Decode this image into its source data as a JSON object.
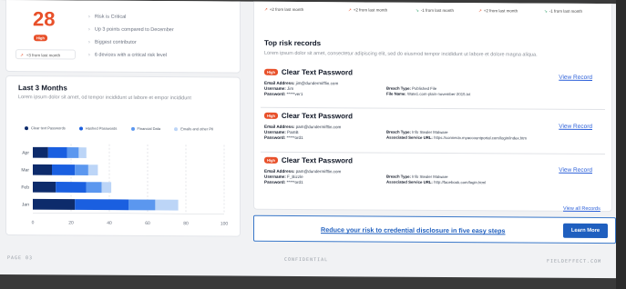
{
  "summary": {
    "risk_score": "28",
    "risk_level": "High",
    "trend_text": "+3 from last month",
    "bullets": [
      "Risk is Critical",
      "Up 3 points compared to December",
      "Biggest contributor",
      "6 devices with a critical risk level"
    ]
  },
  "last_3_months": {
    "title": "Last 3 Months",
    "subtitle": "Lorem ipsum dolor sit amet, od tempor incididunt ut labore et empor incididunt"
  },
  "top_trends": [
    {
      "text": "+2 from last month",
      "direction": "up"
    },
    {
      "text": "+2 from last month",
      "direction": "up"
    },
    {
      "text": "-1 from last month",
      "direction": "down"
    },
    {
      "text": "+2 from last month",
      "direction": "up"
    },
    {
      "text": "-1 from last month",
      "direction": "down"
    }
  ],
  "colors": {
    "accent": "#e8502a",
    "link": "#2b5fd9",
    "cta": "#1f5fbf",
    "series": [
      "#0d2b6b",
      "#1a5fe0",
      "#5b97ef",
      "#bcd5f7"
    ]
  },
  "chart_data": {
    "type": "bar",
    "orientation": "horizontal",
    "stacked": true,
    "categories": [
      "Apr",
      "Mar",
      "Feb",
      "Jan"
    ],
    "series": [
      {
        "name": "Clear text Passwords",
        "values": [
          8,
          10,
          12,
          22
        ]
      },
      {
        "name": "Hashed Passwords",
        "values": [
          10,
          12,
          16,
          28
        ]
      },
      {
        "name": "Financial Data",
        "values": [
          6,
          7,
          8,
          14
        ]
      },
      {
        "name": "Emails and other PII",
        "values": [
          4,
          5,
          5,
          12
        ]
      }
    ],
    "xlim": [
      0,
      100
    ],
    "xticks": [
      "0",
      "20",
      "40",
      "60",
      "80",
      "100"
    ],
    "legend": "top",
    "grid": true
  },
  "records_section": {
    "title": "Top risk records",
    "subtitle": "Lorem ipsum dolor sit amet, consectetur adipiscing elit, sed do eiusmod tempor incididunt ut labore et dolore magna aliqua.",
    "view_label": "View Record",
    "view_all": "View all Records"
  },
  "records": [
    {
      "badge": "High",
      "title": "Clear Text Password",
      "left": [
        {
          "label": "Email Address:",
          "value": "jim@dundermifflin.com"
        },
        {
          "label": "Username:",
          "value": "Jim"
        },
        {
          "label": "Password:",
          "value": "*****ver1"
        }
      ],
      "right": [
        {
          "label": "Breach Type:",
          "value": "Published File"
        },
        {
          "label": "File Name:",
          "value": "Wate1.com-plain-november-2015.txt"
        }
      ]
    },
    {
      "badge": "High",
      "title": "Clear Text Password",
      "left": [
        {
          "label": "Email Address:",
          "value": "pam@dundermifflin.com"
        },
        {
          "label": "Username:",
          "value": "PamB"
        },
        {
          "label": "Password:",
          "value": "*****ord1"
        }
      ],
      "right": [
        {
          "label": "Breach Type:",
          "value": "Info Stealer Malware"
        },
        {
          "label": "Associated Service URL:",
          "value": "https://connectv.myaccountportal.com/login/index.htm"
        }
      ]
    },
    {
      "badge": "High",
      "title": "Clear Text Password",
      "left": [
        {
          "label": "Email Address:",
          "value": "pam@dundermifflin.com"
        },
        {
          "label": "Username:",
          "value": "F_Bizzle"
        },
        {
          "label": "Password:",
          "value": "*****ord1"
        }
      ],
      "right": [
        {
          "label": "Breach Type:",
          "value": "Info Stealer Malware"
        },
        {
          "label": "Associated Service URL:",
          "value": "http://facebook.com/login.html"
        }
      ]
    }
  ],
  "banner": {
    "text": "Reduce your risk to credential disclosure in five easy steps",
    "button": "Learn More"
  },
  "footer": {
    "page": "PAGE 03",
    "center": "CONFIDENTIAL",
    "right": "FIELDEFFECT.COM"
  }
}
